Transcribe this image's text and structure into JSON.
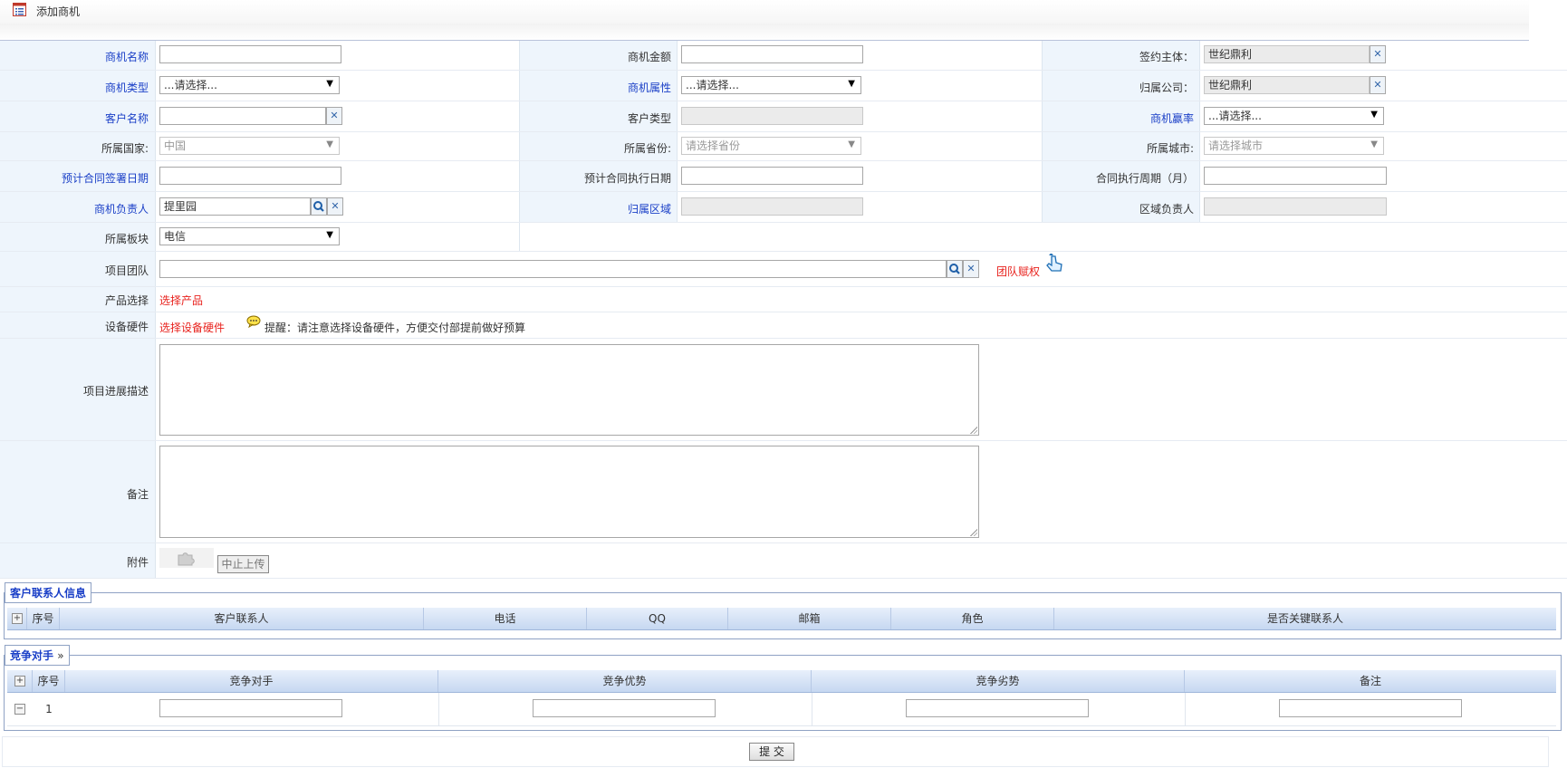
{
  "header": {
    "title": "添加商机"
  },
  "form": {
    "opportunity_name": {
      "label": "商机名称",
      "value": ""
    },
    "opportunity_amount": {
      "label": "商机金额",
      "value": ""
    },
    "signing_entity": {
      "label": "签约主体：",
      "value": "世纪鼎利"
    },
    "opportunity_type": {
      "label": "商机类型",
      "value": "...请选择..."
    },
    "opportunity_attr": {
      "label": "商机属性",
      "value": "...请选择..."
    },
    "company": {
      "label": "归属公司：",
      "value": "世纪鼎利"
    },
    "customer_name": {
      "label": "客户名称",
      "value": ""
    },
    "customer_type": {
      "label": "客户类型",
      "value": ""
    },
    "win_rate": {
      "label": "商机赢率",
      "value": "...请选择..."
    },
    "country": {
      "label": "所属国家:",
      "value": "中国"
    },
    "province": {
      "label": "所属省份:",
      "value": "请选择省份"
    },
    "city": {
      "label": "所属城市:",
      "value": "请选择城市"
    },
    "sign_date": {
      "label": "预计合同签署日期",
      "value": ""
    },
    "exec_date": {
      "label": "预计合同执行日期",
      "value": ""
    },
    "exec_period": {
      "label": "合同执行周期（月）",
      "value": ""
    },
    "owner": {
      "label": "商机负责人",
      "value": "提里园"
    },
    "region": {
      "label": "归属区域",
      "value": ""
    },
    "region_owner": {
      "label": "区域负责人",
      "value": ""
    },
    "sector": {
      "label": "所属板块",
      "value": "电信"
    },
    "team": {
      "label": "项目团队",
      "value": "",
      "authorize_link": "团队赋权"
    },
    "product": {
      "label": "产品选择",
      "link": "选择产品"
    },
    "hardware": {
      "label": "设备硬件",
      "link": "选择设备硬件",
      "tip": "提醒：请注意选择设备硬件，方便交付部提前做好预算"
    },
    "progress": {
      "label": "项目进展描述",
      "value": ""
    },
    "remark": {
      "label": "备注",
      "value": ""
    },
    "attachment": {
      "label": "附件",
      "stop_button": "中止上传"
    }
  },
  "contacts": {
    "legend": "客户联系人信息",
    "columns": [
      "序号",
      "客户联系人",
      "电话",
      "QQ",
      "邮箱",
      "角色",
      "是否关键联系人"
    ]
  },
  "competitors": {
    "legend": "竞争对手",
    "columns": [
      "序号",
      "竞争对手",
      "竞争优势",
      "竞争劣势",
      "备注"
    ],
    "rows": [
      {
        "index": "1"
      }
    ]
  },
  "submit": {
    "label": "提 交"
  },
  "colors": {
    "label_blue": "#1a3fc7",
    "link_red": "#e8221d",
    "label_bg": "#eef5fc"
  },
  "icons": [
    "list-icon",
    "search-icon",
    "clear-icon",
    "hand-pointer-icon",
    "speech-bubble-icon",
    "puzzle-icon",
    "plus-icon",
    "minus-icon",
    "double-chevron-icon"
  ]
}
